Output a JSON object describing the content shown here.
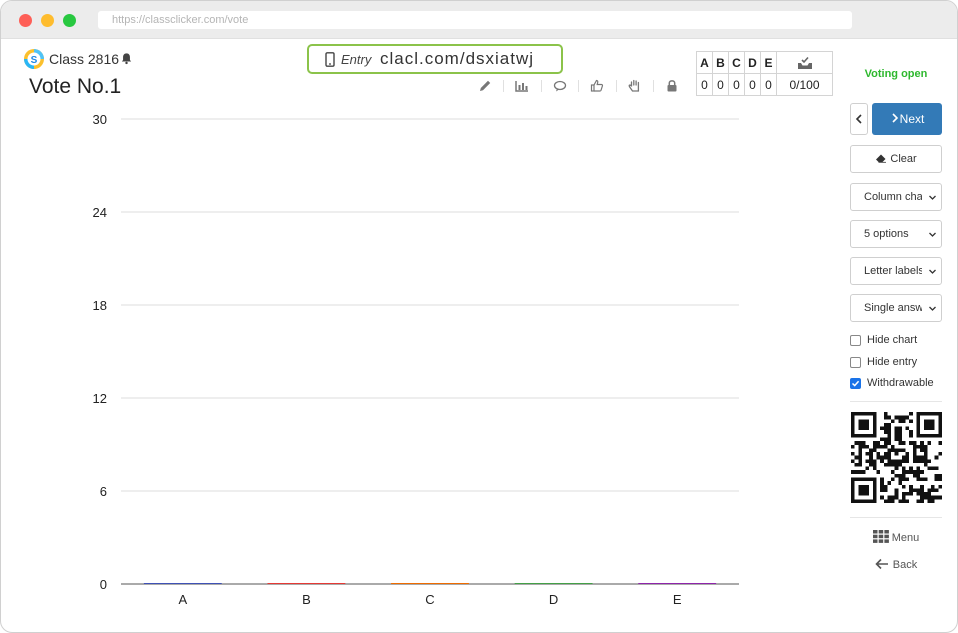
{
  "browser": {
    "url": "https://classclicker.com/vote"
  },
  "header": {
    "class_name": "Class 2816",
    "vote_title": "Vote No.1"
  },
  "entry": {
    "label": "Entry",
    "url": "clacl.com/dsxiatwj"
  },
  "toolbar": {
    "icons": [
      "pencil-icon",
      "chart-icon",
      "comment-icon",
      "thumbs-up-icon",
      "hand-icon",
      "lock-icon"
    ]
  },
  "counts": {
    "headers": [
      "A",
      "B",
      "C",
      "D",
      "E"
    ],
    "values": [
      "0",
      "0",
      "0",
      "0",
      "0"
    ],
    "total": "0/100"
  },
  "chart_data": {
    "type": "bar",
    "categories": [
      "A",
      "B",
      "C",
      "D",
      "E"
    ],
    "values": [
      0,
      0,
      0,
      0,
      0
    ],
    "yticks": [
      "30",
      "24",
      "18",
      "12",
      "6",
      "0"
    ],
    "ylim": [
      0,
      30
    ],
    "grid": true,
    "colors": [
      "#3f51b5",
      "#e53935",
      "#ef6c00",
      "#43a047",
      "#8e24aa"
    ]
  },
  "sidebar": {
    "status": "Voting open",
    "next_label": "Next",
    "clear_label": "Clear",
    "chart_type": "Column chart",
    "options_count": "5 options",
    "label_type": "Letter labels",
    "answer_type": "Single answer",
    "hide_chart_label": "Hide chart",
    "hide_chart_checked": false,
    "hide_entry_label": "Hide entry",
    "hide_entry_checked": false,
    "withdrawable_label": "Withdrawable",
    "withdrawable_checked": true,
    "menu_label": "Menu",
    "back_label": "Back"
  },
  "colors": {
    "accent": "#337ab7",
    "entry_border": "#8bc34a",
    "status_green": "#2eb82e"
  }
}
